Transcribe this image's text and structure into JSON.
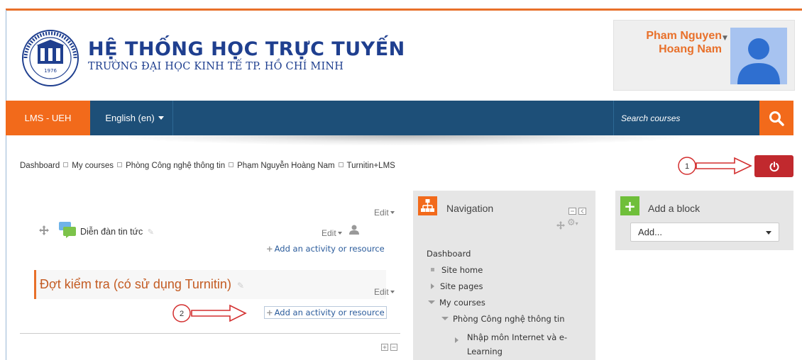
{
  "header": {
    "title": "HỆ THỐNG HỌC TRỰC TUYẾN",
    "subtitle": "TRƯỜNG ĐẠI HỌC KINH TẾ TP. HỒ CHÍ MINH",
    "logo_year": "1976"
  },
  "user": {
    "name_line1": "Pham Nguyen",
    "name_line2": "Hoang Nam"
  },
  "navbar": {
    "home_label": "LMS - UEH",
    "language_label": "English (en)",
    "search_placeholder": "Search courses"
  },
  "breadcrumb": {
    "items": [
      "Dashboard",
      "My courses",
      "Phòng Công nghệ thông tin",
      "Phạm Nguyễn Hoàng Nam",
      "Turnitin+LMS"
    ]
  },
  "course": {
    "edit_label": "Edit",
    "forum_label": "Diễn đàn tin tức",
    "add_activity_label": "Add an activity or resource",
    "section_title": "Đợt kiểm tra (có sử dụng Turnitin)"
  },
  "navigation_block": {
    "title": "Navigation",
    "items": [
      "Dashboard",
      "Site home",
      "Site pages",
      "My courses",
      "Phòng Công nghệ thông tin",
      "Nhập môn Internet và e-",
      "Learning"
    ]
  },
  "add_block": {
    "title": "Add a block",
    "select_value": "Add..."
  },
  "annotations": {
    "marker1": "1",
    "marker2": "2"
  },
  "colors": {
    "accent_orange": "#f26a1b",
    "navbar_blue": "#1d4f78",
    "title_blue": "#1f3f8f",
    "power_red": "#c1292e",
    "annotation_red": "#d32f2f"
  }
}
